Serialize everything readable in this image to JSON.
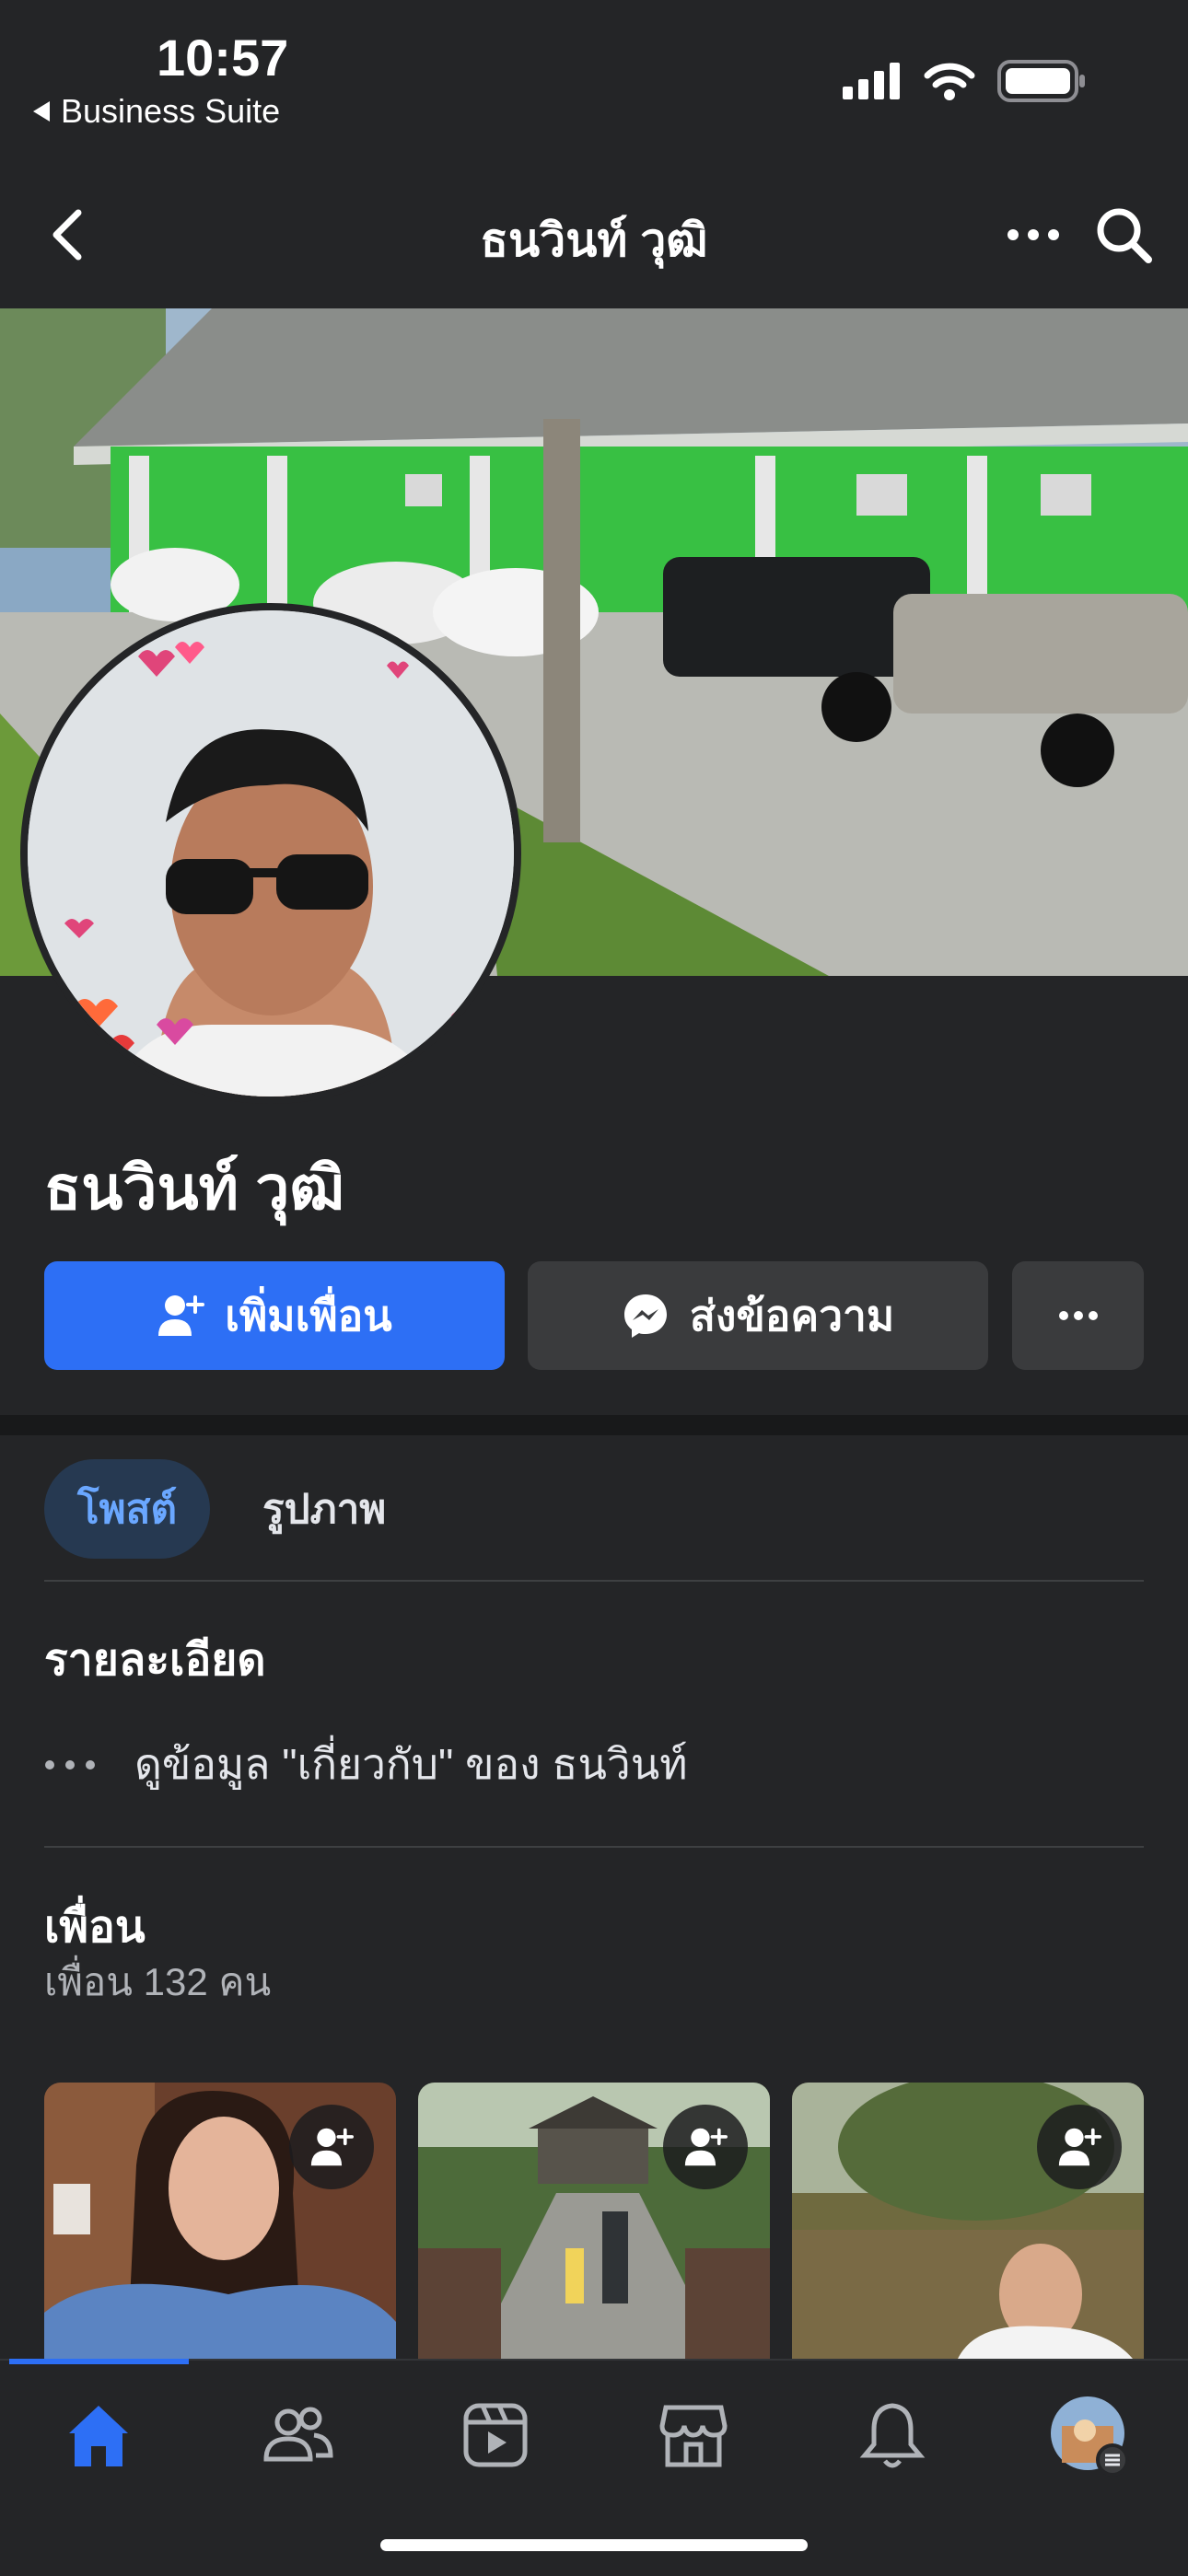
{
  "status_bar": {
    "time": "10:57",
    "back_app_label": "Business Suite",
    "icons": [
      "signal-icon",
      "wifi-icon",
      "battery-icon"
    ]
  },
  "nav": {
    "title": "ธนวินท์ วุฒิ",
    "icons": [
      "back-icon",
      "more-icon",
      "search-icon"
    ]
  },
  "profile": {
    "name": "ธนวินท์ วุฒิ"
  },
  "actions": {
    "add_friend_label": "เพิ่มเพื่อน",
    "message_label": "ส่งข้อความ"
  },
  "tabs": [
    {
      "label": "โพสต์",
      "selected": true
    },
    {
      "label": "รูปภาพ",
      "selected": false
    }
  ],
  "details": {
    "heading": "รายละเอียด",
    "about_link": "ดูข้อมูล \"เกี่ยวกับ\" ของ ธนวินท์"
  },
  "friends": {
    "heading": "เพื่อน",
    "count_text": "เพื่อน 132 คน"
  },
  "bottom_tabs": [
    "home-icon",
    "friends-icon",
    "video-icon",
    "marketplace-icon",
    "notifications-icon",
    "profile-menu-icon"
  ],
  "colors": {
    "background": "#242527",
    "accent": "#2d6ff5",
    "secondary_button": "#3a3b3d",
    "selected_tab_bg": "#263951",
    "selected_tab_text": "#6aa7ff"
  }
}
